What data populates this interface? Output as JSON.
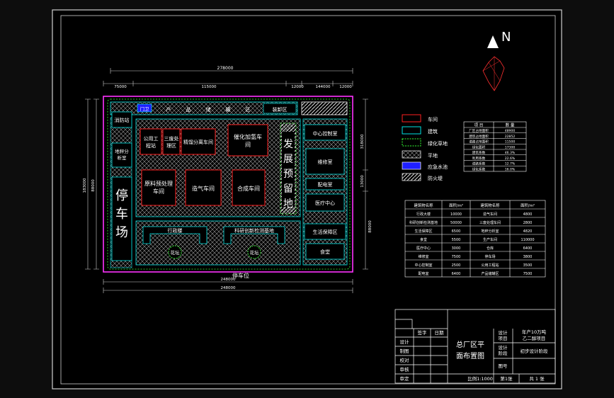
{
  "north_label": "N",
  "dims": {
    "top_total": "278000",
    "top_a": "75000",
    "top_b": "115000",
    "top_c": "12000",
    "top_d": "144000",
    "top_e": "12000",
    "left_a": "183000",
    "left_b": "88000",
    "right_a": "318000",
    "right_b": "13000",
    "right_c": "88000",
    "bottom_a": "248000",
    "bottom_b": "248000"
  },
  "site": {
    "top_strip_left": "门卫",
    "top_strip_chars": [
      "产",
      "品",
      "储",
      "罐",
      "区"
    ],
    "top_strip_right": "装卸区",
    "fire_station": "消防站",
    "weighbridge": "地秤分析室",
    "parking": "停车场",
    "public_station": "公用工程站",
    "tertiary_waste": "三废处理区",
    "refining": "精馏分离车间",
    "hydrogenation": "催化加氢车间",
    "reserve": "发展预留地",
    "pretreat": "原料预处理车间",
    "gas_workshop": "造气车间",
    "synthesis": "合成车间",
    "control_room": "中心控制室",
    "repair": "维修室",
    "distribution": "配电室",
    "medical": "医疗中心",
    "office": "行政楼",
    "research": "科研创新检测基地",
    "garden1": "花坛",
    "garden2": "花坛",
    "living": "生活保障区",
    "canteen": "食堂",
    "parking_bottom": "停车位"
  },
  "legend": [
    {
      "label": "车间",
      "swatch": "red",
      "color": "#ff2020"
    },
    {
      "label": "建筑",
      "swatch": "cyan",
      "color": "#00e5e5"
    },
    {
      "label": "绿化草地",
      "swatch": "green-dashed",
      "color": "#33ff33"
    },
    {
      "label": "平地",
      "swatch": "crosshatch",
      "color": "#ffffff"
    },
    {
      "label": "应急水池",
      "swatch": "blue",
      "color": "#1f1fff"
    },
    {
      "label": "防火堤",
      "swatch": "hatch",
      "color": "#ffffff"
    }
  ],
  "stats_table": {
    "headers": [
      "项 目",
      "数 量"
    ],
    "rows": [
      [
        "厂区占地面积",
        "48900"
      ],
      [
        "建筑占地面积",
        "22852"
      ],
      [
        "道路占地面积",
        "11500"
      ],
      [
        "绿化面积",
        "17300"
      ],
      [
        "建筑系数",
        "46.3%"
      ],
      [
        "利用系数",
        "22.6%"
      ],
      [
        "道路系数",
        "12.7%"
      ],
      [
        "绿化系数",
        "16.0%"
      ]
    ]
  },
  "area_table": {
    "headers": [
      "建筑物名称",
      "面积/m²",
      "建筑物名称",
      "面积/m²"
    ],
    "rows": [
      [
        "行政大楼",
        "10000",
        "造气车间",
        "4800"
      ],
      [
        "科研创新检测基地",
        "50000",
        "三废处理车间",
        "2800"
      ],
      [
        "生活保障区",
        "6500",
        "地秤分析室",
        "4820"
      ],
      [
        "食堂",
        "5500",
        "生产车间",
        "110000"
      ],
      [
        "医疗中心",
        "3000",
        "仓库",
        "6400"
      ],
      [
        "维修室",
        "7500",
        "停车场",
        "3800"
      ],
      [
        "中心控制室",
        "2500",
        "公用工程站",
        "3500"
      ],
      [
        "配电室",
        "6400",
        "产品储罐区",
        "7500"
      ]
    ]
  },
  "title_block": {
    "col_sign": "签字",
    "col_date": "日期",
    "rows": [
      "设计",
      "制图",
      "校对",
      "审核",
      "审定"
    ],
    "drawing_title": "总厂区平面布置图",
    "project_label": "设计项目",
    "project_value": "年产10万吨乙二醇项目",
    "stage_label": "设计阶段",
    "stage_value": "初步设计阶段",
    "drawing_no": "图号",
    "scale": "比例1:1000",
    "sheet": "第1张",
    "total": "共 1 张"
  }
}
